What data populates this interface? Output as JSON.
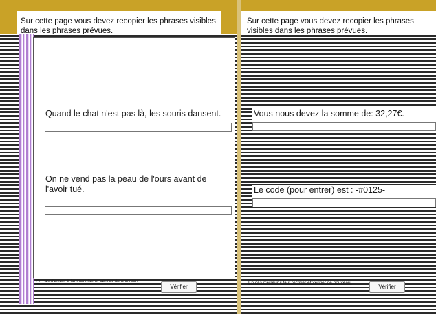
{
  "left": {
    "header": "Sur cette page vous devez recopier les phrases visibles dans les phrases prévues.",
    "sentences": [
      "Quand le chat n'est pas là, les souris dansent.",
      "On ne vend pas la peau de l'ours avant de l'avoir tué."
    ],
    "note": "En cas d'erreur il faut rectifier  et vérifier de nouveau.",
    "verify": "Vérifier"
  },
  "right": {
    "header": "Sur cette page vous devez recopier les phrases visibles dans les phrases prévues.",
    "sentences": [
      "Vous nous devez la somme de: 32,27€.",
      "Le code (pour entrer) est : -#0125-"
    ],
    "note": "En cas d'erreur il faut rectifier  et vérifier de nouveau.",
    "verify": "Vérifier"
  },
  "colors": {
    "frame": "#c9a227",
    "panel": "#ffffff",
    "stripe": "#2a2a2a"
  }
}
